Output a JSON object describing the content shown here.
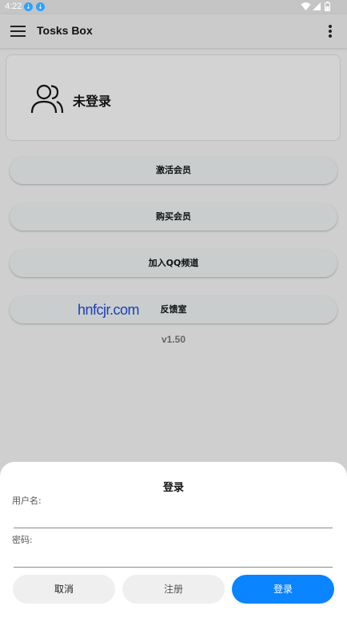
{
  "status_bar": {
    "time": "4:22",
    "notif_icons": [
      "download-icon",
      "download-icon"
    ]
  },
  "app_bar": {
    "title": "Tosks Box"
  },
  "profile": {
    "login_status": "未登录"
  },
  "menu": {
    "buttons": [
      {
        "label": "激活会员"
      },
      {
        "label": "购买会员"
      },
      {
        "label": "加入QQ频道"
      },
      {
        "label": "反馈室"
      }
    ]
  },
  "watermark": "hnfcjr.com",
  "version": "v1.50",
  "dialog": {
    "title": "登录",
    "username_label": "用户名:",
    "username_value": "",
    "password_label": "密码:",
    "password_value": "",
    "cancel_label": "取消",
    "register_label": "注册",
    "login_label": "登录"
  },
  "colors": {
    "primary": "#0a84ff",
    "dim_background": "#cfcfcf",
    "button_gray": "#c9cdcd"
  }
}
